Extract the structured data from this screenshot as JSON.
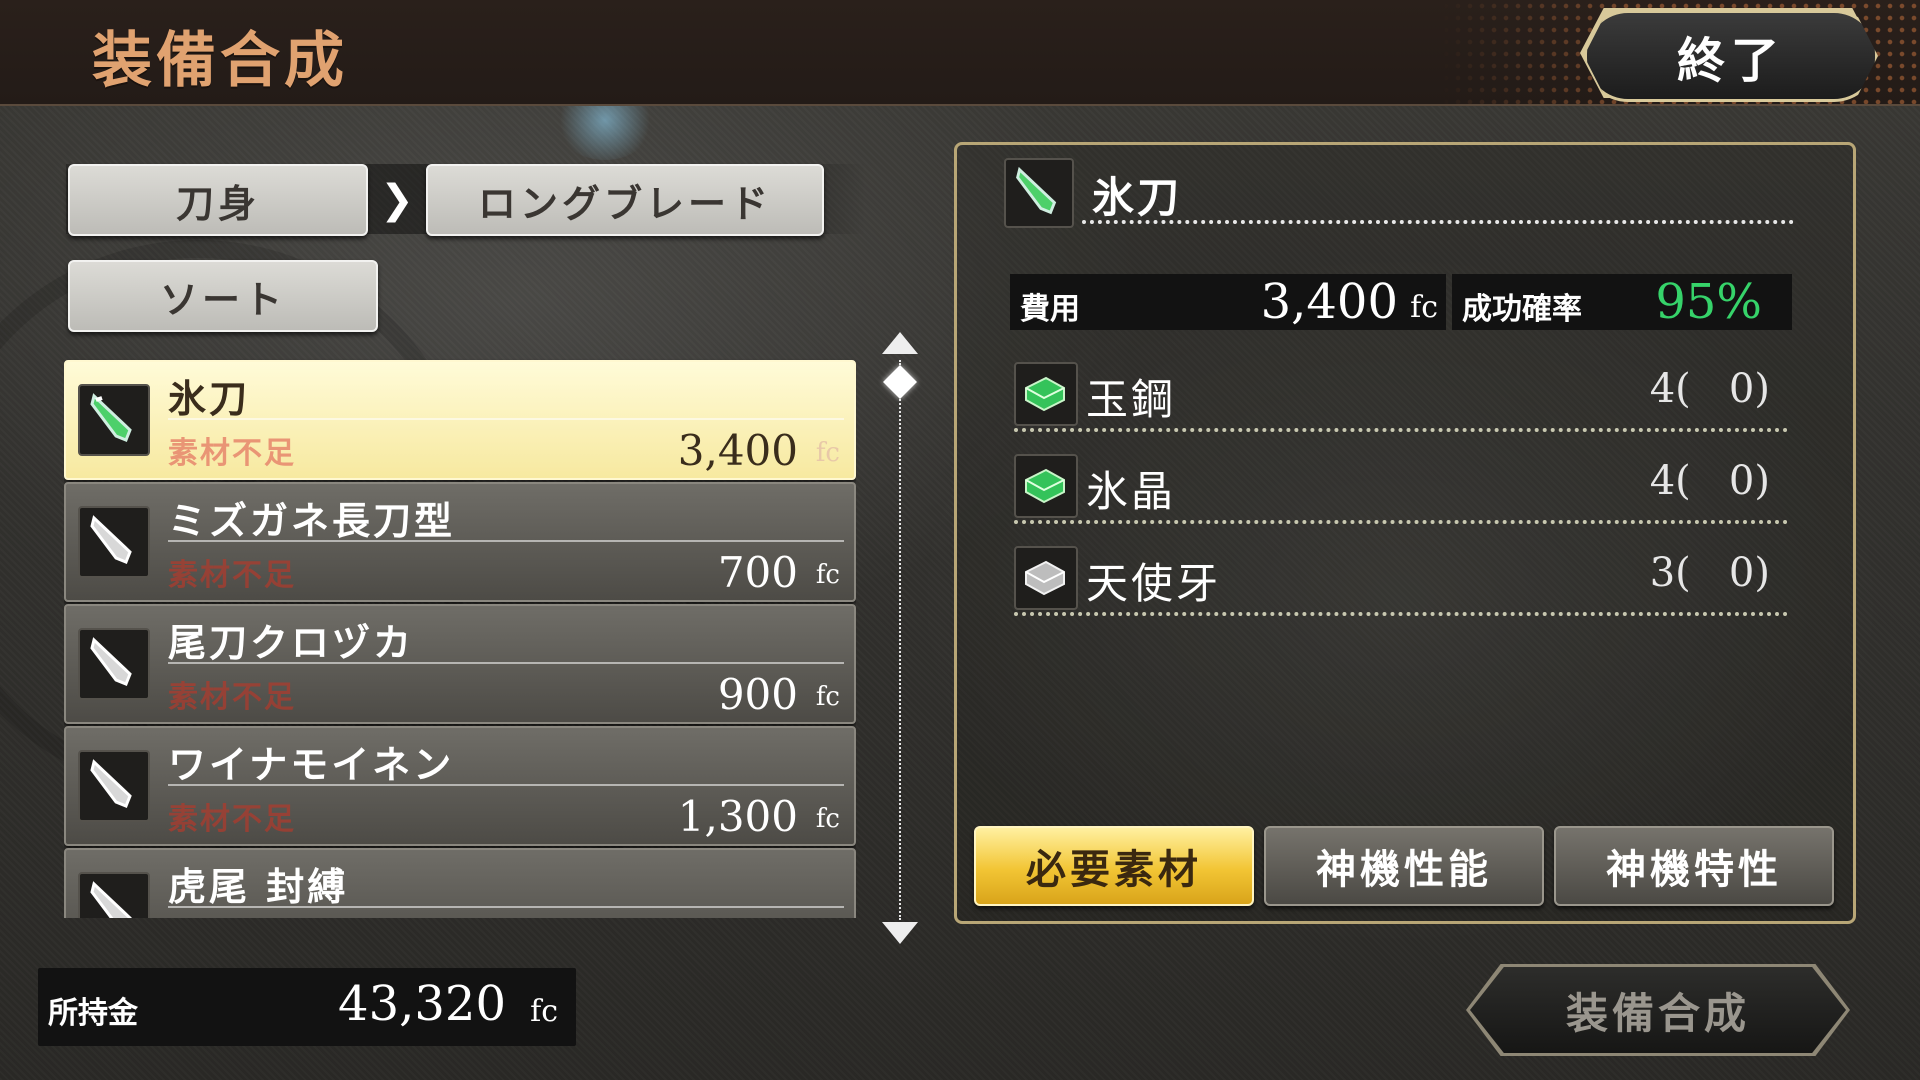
{
  "header": {
    "title": "装備合成",
    "exit_label": "終了"
  },
  "breadcrumb": {
    "category": "刀身",
    "separator": "❯",
    "subcategory": "ロングブレード"
  },
  "sort_label": "ソート",
  "currency_unit": "fc",
  "items": [
    {
      "name": "氷刀",
      "status": "素材不足",
      "price": "3,400",
      "selected": true
    },
    {
      "name": "ミズガネ長刀型",
      "status": "素材不足",
      "price": "700",
      "selected": false
    },
    {
      "name": "尾刀クロヅカ",
      "status": "素材不足",
      "price": "900",
      "selected": false
    },
    {
      "name": "ワイナモイネン",
      "status": "素材不足",
      "price": "1,300",
      "selected": false
    },
    {
      "name": "虎尾 封縛",
      "status": "",
      "price": "",
      "selected": false
    }
  ],
  "wallet": {
    "label": "所持金",
    "value": "43,320"
  },
  "detail": {
    "name": "氷刀",
    "cost_label": "費用",
    "cost_value": "3,400",
    "rate_label": "成功確率",
    "rate_value": "95%",
    "materials": [
      {
        "name": "玉鋼",
        "qty": "4(   0)",
        "icon": "green-crystal-icon"
      },
      {
        "name": "氷晶",
        "qty": "4(   0)",
        "icon": "green-crystal-icon"
      },
      {
        "name": "天使牙",
        "qty": "3(   0)",
        "icon": "silver-crystal-icon"
      }
    ]
  },
  "tabs": [
    {
      "label": "必要素材",
      "active": true
    },
    {
      "label": "神機性能",
      "active": false
    },
    {
      "label": "神機特性",
      "active": false
    }
  ],
  "synth_button_label": "装備合成",
  "colors": {
    "title": "#e0a270",
    "success_rate": "#36d36a",
    "status_warning": "#b23a2c",
    "active_tab": "#f2c534",
    "panel_border": "#b8a676"
  }
}
